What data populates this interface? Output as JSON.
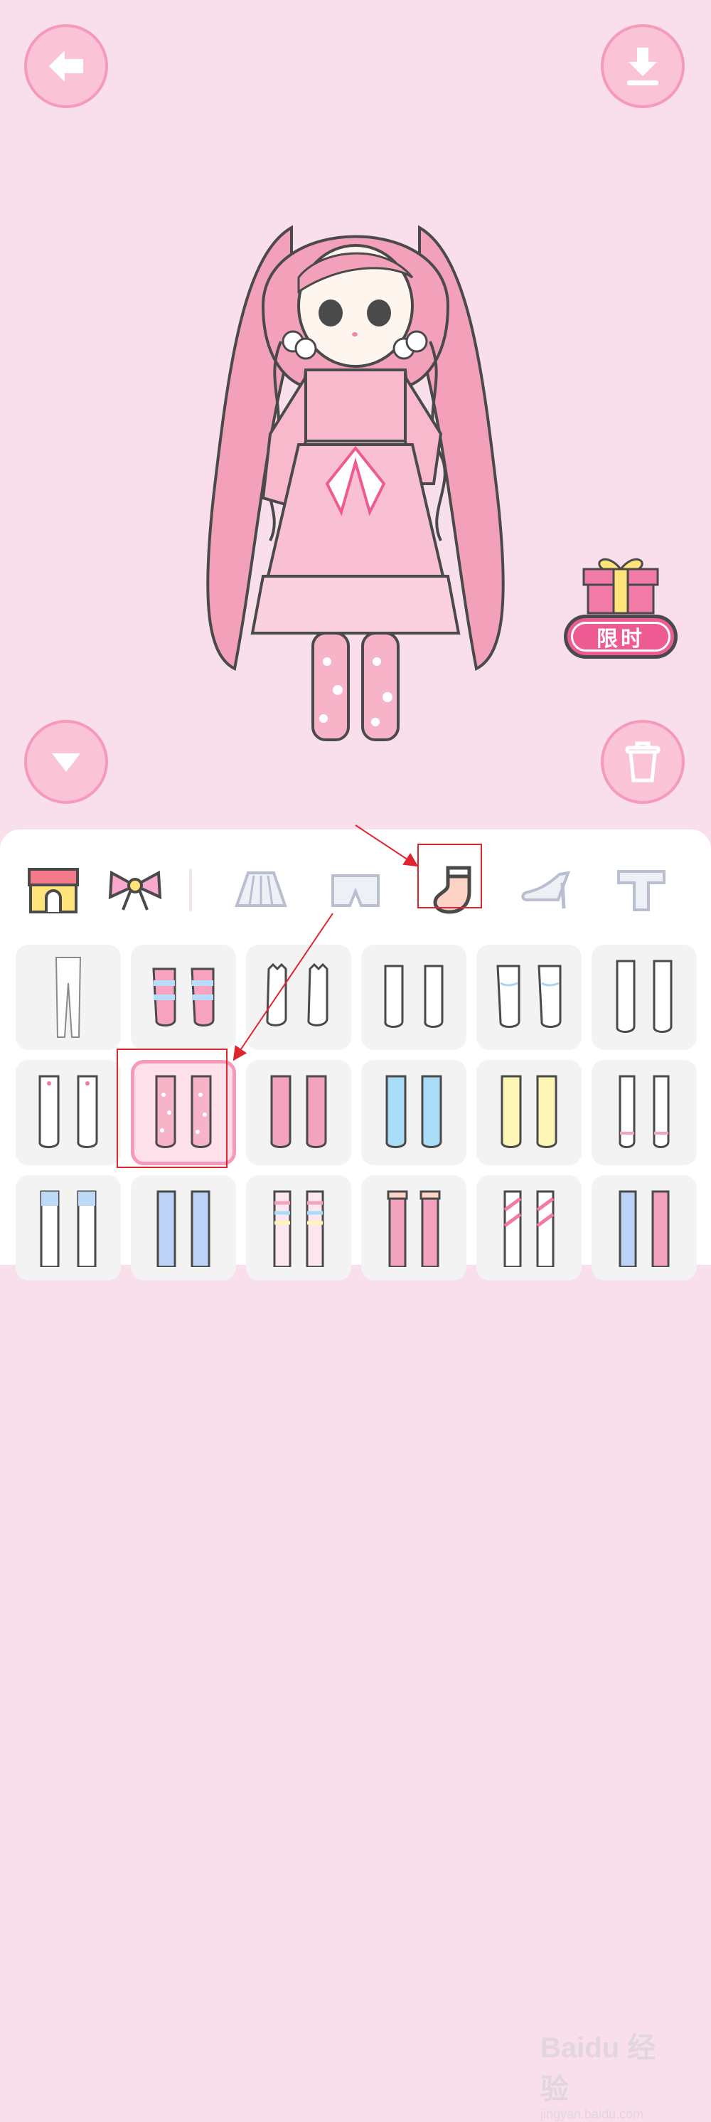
{
  "toolbar": {
    "back_icon": "arrow-left-icon",
    "download_icon": "download-icon",
    "collapse_icon": "triangle-down-icon",
    "trash_icon": "trash-icon"
  },
  "gift": {
    "label": "限时",
    "icon": "gift-icon"
  },
  "categories": [
    {
      "name": "shop",
      "icon": "shop-icon"
    },
    {
      "name": "bow",
      "icon": "bow-icon"
    },
    {
      "name": "skirt",
      "icon": "skirt-icon"
    },
    {
      "name": "shorts",
      "icon": "shorts-icon"
    },
    {
      "name": "socks",
      "icon": "sock-icon",
      "selected": true
    },
    {
      "name": "heels",
      "icon": "high-heel-icon"
    },
    {
      "name": "tshirt",
      "icon": "tshirt-icon"
    }
  ],
  "items": [
    {
      "style": "white-tights"
    },
    {
      "style": "pink-blue-stripe-socks"
    },
    {
      "style": "white-frill-socks"
    },
    {
      "style": "white-knee-socks"
    },
    {
      "style": "white-slouch-socks"
    },
    {
      "style": "white-long-socks"
    },
    {
      "style": "white-heart-socks"
    },
    {
      "style": "pink-polka-dot-socks",
      "selected": true
    },
    {
      "style": "pink-knee-socks"
    },
    {
      "style": "blue-knee-socks"
    },
    {
      "style": "yellow-knee-socks"
    },
    {
      "style": "white-lace-socks"
    },
    {
      "style": "white-blue-leg-warmers"
    },
    {
      "style": "blue-slouch-socks"
    },
    {
      "style": "rainbow-stripe-socks"
    },
    {
      "style": "pink-frill-socks"
    },
    {
      "style": "pink-diagonal-stripe-socks"
    },
    {
      "style": "blue-pink-socks"
    }
  ],
  "watermark": {
    "main": "Baidu 经验",
    "sub": "jingyan.baidu.com"
  },
  "colors": {
    "background": "#f9dfeb",
    "button": "#fbc3d6",
    "button_border": "#f59abb",
    "accent": "#ee5b93"
  }
}
